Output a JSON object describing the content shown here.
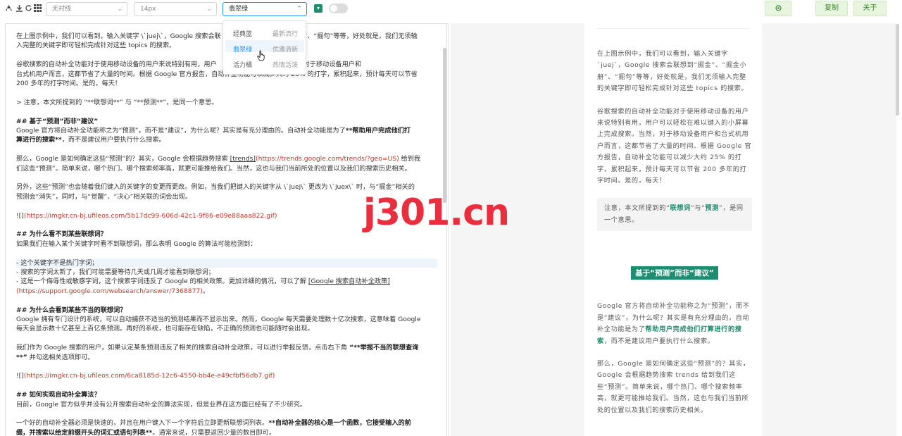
{
  "toolbar": {
    "icons": [
      "logo-icon",
      "download-icon",
      "refresh-icon",
      "grid-icon"
    ],
    "code_theme_select": "无衬线",
    "font_size_select": "14px",
    "theme_select": "翡翠绿",
    "theme_color": "#1e8c6e",
    "buttons": {
      "settings_icon": "gear-icon",
      "copy": "复制",
      "about": "关于"
    }
  },
  "dropdown": {
    "options": [
      {
        "left": "经典蓝",
        "right": "最新流行"
      },
      {
        "left": "翡翠绿",
        "right": "优雅清新"
      },
      {
        "left": "活力橘",
        "right": "热情活泼"
      }
    ]
  },
  "editor": {
    "l1": "在上图示例中，我们可以看到，输入关键字 \\`juej\\`，Google 搜索会联",
    "l1b": "、“掘金”、“掘金小册”、“掘句”等等，好处就是，我们无须输",
    "l2": "入完整的关键字即可轻松完成针对这些 topics 的搜索。",
    "l4": "谷歌搜索的自动补全功能对于使用移动设备的用户来说特别有用，用户",
    "l4b": "上完成搜索。当然，对于移动设备用户和",
    "l5": "台式机用户而言，这都节省了大量的时间。根据 Google 官方报告，自动补全功能可以减少大约 25% 的打字，累积起来，预计每天可以节省",
    "l6": "200 多年的打字时间。是的，每天！",
    "l8": "> 注意，本文所提到的 “**联想词**” 与 “**预测**”，是同一个意思。",
    "l10": "## 基于“预测”而非“建议”",
    "l11a": "Google 官方将自动补全功能称之为“预测”，而不是“建议”，为什么呢？其实是有充分理由的。自动补全功能是为了",
    "l11b": "**帮助用户完成他们打",
    "l12a": "算进行的搜索**",
    "l12b": "，而不是建议用户要执行什么搜索。",
    "l14a": "那么，Google 是如何确定这些“预测”的？其实，Google 会根据趋势搜索 ",
    "l14b": "[trends]",
    "l14c": "(https://trends.google.com/trends/?geo=US)",
    "l14d": " 给到我",
    "l15": "们这些“预测”。简单来说，哪个热门、哪个搜索频率高，就更可能推给我们。当然，这也与我们当前所处的位置以及我们的搜索历史相关。",
    "l17": "另外，这些“预测”也会随着我们键入的关键字的变更而更改。例如，当我们把键入的关键字从 \\`juej\\` 更改为 \\`juex\\` 时，与“掘金”相关的",
    "l18": "预测会“消失”，同时，与“觉醒”、“决心”相关联的词会出现。",
    "l20a": "![]",
    "l20b": "(https://imgkr.cn-bj.ufileos.com/5b17dc99-606d-42c1-9f86-e09e88aaa822.gif)",
    "l22": "## 为什么看不到某些联想词？",
    "l23": "如果我们在输入某个关键字时看不到联想词，那么表明 Google 的算法可能检测到：",
    "l25": "- 这个关键字不是热门字词；",
    "l26": "- 搜索的字词太新了，我们可能需要等待几天或几周才能看到联想词；",
    "l27a": "- 这是一个侮辱性或敏感字词，这个搜索字词违反了 Google 的相关政策。更加详细的情况，可以了解 ",
    "l27b": "[Google 搜索自动补全政策]",
    "l28": "(https://support.google.com/websearch/answer/7368877)",
    "l28b": "。",
    "l30": "## 为什么会看到某些不当的联想词？",
    "l31": "Google 拥有专门设计的系统，可以自动捕获不适当的预测结果而不显示出来。然而，Google 每天需要处理数十亿次搜索，这意味着 Google",
    "l32": "每天会显示数十亿甚至上百亿条预测。再好的系统，也可能存在缺陷，不正确的预测也可能随时会出现。",
    "l34a": "我们作为 Google 搜索的用户，如果认定某条预测违反了相关的搜索自动补全政策，可以进行举报反馈，点击右下角 ",
    "l34b": "“**举报不当的联想查询",
    "l35a": "**”",
    "l35b": " 并勾选相关选项即可。",
    "l37a": "![]",
    "l37b": "(https://imgkr.cn-bj.ufileos.com/6ca8185d-12c6-4550-bb4e-e49cfbf56db7.gif)",
    "l39": "## 如何实现自动补全算法？",
    "l40": "目前，Google 官方似乎并没有公开搜索自动补全的算法实现，但是业界在这方面已经有了不少研究。",
    "l42a": "一个好的自动补全器必须是快速的，并且在用户键入下一个字符后立即更新联想词列表。",
    "l42b": "**自动补全器的核心是一个函数，它接受输入的前",
    "l43a": "缀，并搜索以给定前缀开头的词汇或语句列表**",
    "l43b": "。通常来说，只需要返回少量的数目即可。"
  },
  "preview": {
    "p1": "在上图示例中，我们可以看到，输入关键字 `juej`，Google 搜索会联想到“掘金”、“掘金小册”、“掘句”等等，好处就是，我们无须输入完整的关键字即可轻松完成针对这些 topics 的搜索。",
    "p2": "谷歌搜索的自动补全功能对于使用移动设备的用户来说特别有用，用户可以轻松在难以键入的小屏幕上完成搜索。当然，对于移动设备用户和台式机用户而言，这都节省了大量的时间。根据 Google 官方报告，自动补全功能可以减少大约 25% 的打字，累积起来，预计每天可以节省 200 多年的打字时间。是的，每天！",
    "q1": "注意，本文所提到的“",
    "q2": "联想词",
    "q3": "”与“",
    "q4": "预测",
    "q5": "”，是同一个意思。",
    "h2": "基于“预测”而非“建议”",
    "p3a": "Google 官方将自动补全功能称之为“预测”，而不是“建议”，为什么呢？其实是有充分理由的。自动补全功能是为了",
    "p3b": "帮助用户完成他们打算进行的搜索",
    "p3c": "，而不是建议用户要执行什么搜索。",
    "p4": "那么，Google 是如何确定这些“预测”的？其实，Google 会根据趋势搜索 trends 给到我们这些“预测”。简单来说，哪个热门、哪个搜索频率高，就更可能推给我们。当然，这也与我们当前所处的位置以及我们的搜索历史相关。"
  },
  "watermark": "j301.cn"
}
